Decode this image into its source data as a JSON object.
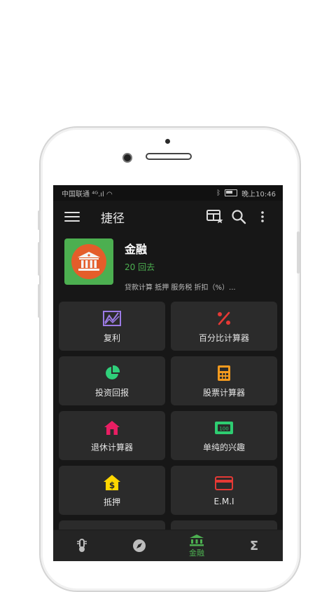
{
  "statusbar": {
    "carrier": "中国联通",
    "signal": "⁴ᴳ.ıl",
    "time": "晚上10:46"
  },
  "appbar": {
    "title": "捷径",
    "icons": [
      "menu-icon",
      "widget-star-icon",
      "search-icon",
      "more-vert-icon"
    ]
  },
  "header": {
    "name": "金融",
    "count": "20 回去",
    "description": "贷款计算 抵押 服务税 折扣（%）..."
  },
  "tiles": [
    {
      "label": "复利",
      "icon": "line-chart-icon",
      "color": "#9c7be6"
    },
    {
      "label": "百分比计算器",
      "icon": "percent-icon",
      "color": "#e53935"
    },
    {
      "label": "投资回报",
      "icon": "pie-chart-icon",
      "color": "#2fd07a"
    },
    {
      "label": "股票计算器",
      "icon": "calculator-icon",
      "color": "#f39a1e"
    },
    {
      "label": "退休计算器",
      "icon": "house-icon",
      "color": "#e91e63"
    },
    {
      "label": "单纯的兴趣",
      "icon": "money-bill-icon",
      "color": "#2ecc71"
    },
    {
      "label": "抵押",
      "icon": "dollar-house-icon",
      "color": "#ffd600"
    },
    {
      "label": "E.M.I",
      "icon": "credit-card-icon",
      "color": "#e53935"
    }
  ],
  "bottomnav": {
    "items": [
      {
        "icon": "thermometer-icon",
        "label": ""
      },
      {
        "icon": "compass-icon",
        "label": ""
      },
      {
        "icon": "bank-icon",
        "label": "金融",
        "active": true
      },
      {
        "icon": "sigma-icon",
        "label": ""
      }
    ]
  },
  "colors": {
    "accent": "#4caf50",
    "background": "#171717",
    "tile": "#2b2b2b"
  }
}
